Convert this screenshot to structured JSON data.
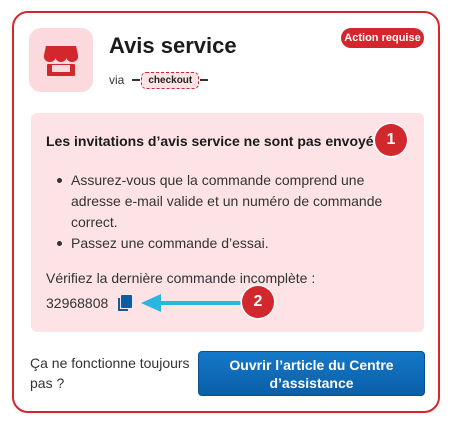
{
  "header": {
    "title": "Avis service",
    "via_label": "via",
    "source_chip": "checkout",
    "status_badge": "Action requise",
    "icon": "store-icon"
  },
  "alert": {
    "title": "Les invitations d’avis service ne sont pas envoyées.",
    "step_1": "1",
    "tips": [
      "Assurez-vous que la commande comprend une adresse e-mail valide et un numéro de commande correct.",
      "Passez une commande d’essai."
    ],
    "check_label": "Vérifiez la dernière commande incomplète :",
    "order_number": "32968808",
    "copy_icon": "copy-icon",
    "step_2": "2"
  },
  "footer": {
    "question": "Ça ne fonctionne toujours pas ?",
    "button_label": "Ouvrir l’article du Centre d’assistance"
  },
  "colors": {
    "accent_red": "#d3272e",
    "alert_bg": "#fde3e6",
    "button_blue": "#0a6bb9",
    "arrow_cyan": "#29b6e0"
  }
}
